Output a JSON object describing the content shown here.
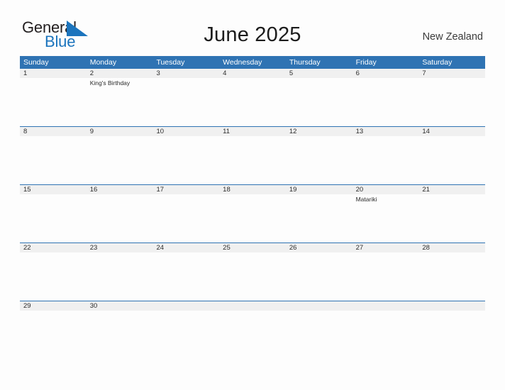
{
  "brand": {
    "word_one": "General",
    "word_two": "Blue",
    "flag_icon": "blue-flag-triangle-icon",
    "dark_color": "#231f20",
    "blue_color": "#1b74bd"
  },
  "header": {
    "title": "June 2025",
    "region": "New Zealand"
  },
  "theme": {
    "header_blue": "#2f73b3",
    "row_rule_blue": "#2f73b3",
    "daynum_band_gray": "#f0f0f0",
    "page_background": "#fdfdfd",
    "text_color": "#2b2b2b"
  },
  "calendar": {
    "weekday_headers": [
      "Sunday",
      "Monday",
      "Tuesday",
      "Wednesday",
      "Thursday",
      "Friday",
      "Saturday"
    ],
    "weeks": [
      {
        "days": [
          {
            "number": "1",
            "events": []
          },
          {
            "number": "2",
            "events": [
              "King's Birthday"
            ]
          },
          {
            "number": "3",
            "events": []
          },
          {
            "number": "4",
            "events": []
          },
          {
            "number": "5",
            "events": []
          },
          {
            "number": "6",
            "events": []
          },
          {
            "number": "7",
            "events": []
          }
        ]
      },
      {
        "days": [
          {
            "number": "8",
            "events": []
          },
          {
            "number": "9",
            "events": []
          },
          {
            "number": "10",
            "events": []
          },
          {
            "number": "11",
            "events": []
          },
          {
            "number": "12",
            "events": []
          },
          {
            "number": "13",
            "events": []
          },
          {
            "number": "14",
            "events": []
          }
        ]
      },
      {
        "days": [
          {
            "number": "15",
            "events": []
          },
          {
            "number": "16",
            "events": []
          },
          {
            "number": "17",
            "events": []
          },
          {
            "number": "18",
            "events": []
          },
          {
            "number": "19",
            "events": []
          },
          {
            "number": "20",
            "events": [
              "Matariki"
            ]
          },
          {
            "number": "21",
            "events": []
          }
        ]
      },
      {
        "days": [
          {
            "number": "22",
            "events": []
          },
          {
            "number": "23",
            "events": []
          },
          {
            "number": "24",
            "events": []
          },
          {
            "number": "25",
            "events": []
          },
          {
            "number": "26",
            "events": []
          },
          {
            "number": "27",
            "events": []
          },
          {
            "number": "28",
            "events": []
          }
        ]
      },
      {
        "days": [
          {
            "number": "29",
            "events": []
          },
          {
            "number": "30",
            "events": []
          },
          {
            "number": "",
            "events": []
          },
          {
            "number": "",
            "events": []
          },
          {
            "number": "",
            "events": []
          },
          {
            "number": "",
            "events": []
          },
          {
            "number": "",
            "events": []
          }
        ]
      }
    ]
  }
}
